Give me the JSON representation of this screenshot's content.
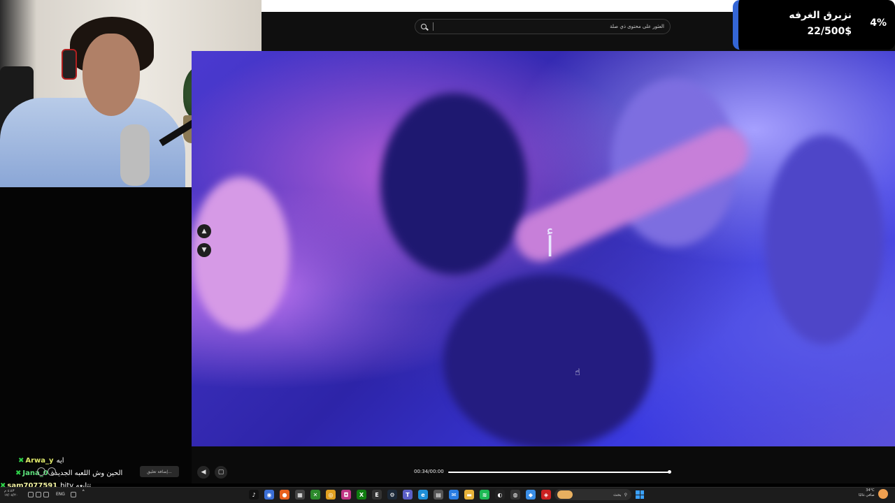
{
  "search": {
    "placeholder": "العثور على محتوى ذي صلة"
  },
  "goal": {
    "title": "نزبرق الغرفه",
    "progress": "22/500$",
    "percent": "4%"
  },
  "video": {
    "caption": "أ"
  },
  "player": {
    "time": "00:34/00:00",
    "progress_fraction": 0.99
  },
  "chat": {
    "messages": [
      {
        "user": "Arwa_y",
        "text": "ايه"
      },
      {
        "user": "Jana_0",
        "text": "الحين وش اللعبه الجديدة"
      },
      {
        "user": "sam7077591",
        "text": "hitv تتابعه"
      }
    ],
    "input_placeholder": "إضافة تعليق..."
  },
  "taskbar": {
    "language": "ENG",
    "search_label": "بحث",
    "tray_left_lines": [
      "٤:٤٣ م",
      "١٧/٠٨/٢٠"
    ],
    "weather": "34°C",
    "weather_desc": "صافي غالبًا",
    "apps": [
      {
        "name": "tiktok-icon",
        "color": "#111111",
        "glyph": "♪"
      },
      {
        "name": "browser-icon",
        "color": "#3b6fd6",
        "glyph": "◉"
      },
      {
        "name": "firefox-icon",
        "color": "#e8601c",
        "glyph": "●"
      },
      {
        "name": "calculator-icon",
        "color": "#444444",
        "glyph": "▦"
      },
      {
        "name": "xbox-icon",
        "color": "#2c8a2c",
        "glyph": "✕"
      },
      {
        "name": "chrome-icon",
        "color": "#e0a020",
        "glyph": "◎"
      },
      {
        "name": "instagram-icon",
        "color": "#c13584",
        "glyph": "◘"
      },
      {
        "name": "xbox-app-icon",
        "color": "#107c10",
        "glyph": "X"
      },
      {
        "name": "epic-icon",
        "color": "#333333",
        "glyph": "E"
      },
      {
        "name": "steam-icon",
        "color": "#1b2838",
        "glyph": "⚙"
      },
      {
        "name": "teams-icon",
        "color": "#5b5fc7",
        "glyph": "T"
      },
      {
        "name": "edge-icon",
        "color": "#1f8fd6",
        "glyph": "e"
      },
      {
        "name": "store-icon",
        "color": "#555555",
        "glyph": "▤"
      },
      {
        "name": "mail-icon",
        "color": "#2a7de1",
        "glyph": "✉"
      },
      {
        "name": "folder-icon",
        "color": "#e8b33a",
        "glyph": "▬"
      },
      {
        "name": "spotify-icon",
        "color": "#1db954",
        "glyph": "≋"
      },
      {
        "name": "github-icon",
        "color": "#222222",
        "glyph": "◐"
      },
      {
        "name": "obs-icon",
        "color": "#333333",
        "glyph": "◍"
      },
      {
        "name": "photos-icon",
        "color": "#3a8ee6",
        "glyph": "◆"
      },
      {
        "name": "antivirus-icon",
        "color": "#cc2222",
        "glyph": "◈"
      },
      {
        "name": "window-icon",
        "color": "#333333",
        "glyph": "▭"
      }
    ]
  }
}
